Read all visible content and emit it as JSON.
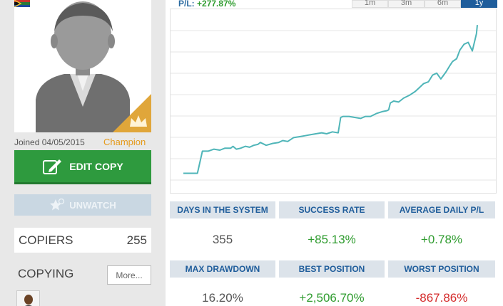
{
  "profile": {
    "joined_text": "Joined 04/05/2015",
    "rank_label": "Champion",
    "edit_copy_label": "EDIT COPY",
    "unwatch_label": "UNWATCH",
    "copiers_label": "COPIERS",
    "copiers_count": "255",
    "copying_label": "COPYING",
    "more_label": "More..."
  },
  "performance": {
    "pl_label": "P/L:",
    "pl_value": "+277.87%",
    "ranges": [
      "1m",
      "3m",
      "6m",
      "1y"
    ],
    "active_range": "1y"
  },
  "stats": {
    "days_label": "DAYS IN THE SYSTEM",
    "days_value": "355",
    "success_label": "SUCCESS RATE",
    "success_value": "+85.13%",
    "avg_label": "AVERAGE DAILY P/L",
    "avg_value": "+0.78%",
    "drawdown_label": "MAX DRAWDOWN",
    "drawdown_value": "16.20%",
    "best_label": "BEST POSITION",
    "best_value": "+2,506.70%",
    "worst_label": "WORST POSITION",
    "worst_value": "-867.86%"
  },
  "colors": {
    "line": "#4fb5b8",
    "accent": "#1f5d9b",
    "positive": "#2f9c2f",
    "negative": "#d42a2a"
  },
  "chart_data": {
    "type": "line",
    "title": "",
    "xlabel": "",
    "ylabel": "",
    "grid": true,
    "x": [
      0,
      4,
      9,
      14,
      17,
      23,
      30,
      37,
      44,
      50,
      57,
      60,
      64,
      69,
      75,
      80,
      85,
      90,
      93,
      100,
      108,
      115,
      120,
      126,
      133,
      140,
      147,
      153,
      160,
      167,
      173,
      180,
      187,
      190,
      193,
      200,
      207,
      214,
      220,
      226,
      233,
      240,
      246,
      248,
      250,
      254,
      260,
      266,
      273,
      280,
      285,
      290,
      296,
      301,
      306,
      311,
      317,
      322,
      325,
      330,
      334,
      339,
      344,
      349,
      354,
      355
    ],
    "y": [
      0,
      0,
      0,
      0,
      0,
      2.3,
      2.3,
      2.5,
      2.4,
      2.6,
      2.6,
      2.8,
      2.5,
      2.6,
      2.8,
      2.7,
      2.9,
      3.0,
      3.2,
      2.9,
      3.1,
      3.2,
      3.4,
      3.3,
      3.7,
      3.8,
      3.9,
      4.0,
      4.1,
      4.2,
      4.1,
      4.3,
      4.2,
      5.8,
      5.9,
      5.9,
      5.8,
      5.7,
      5.9,
      5.9,
      6.2,
      6.4,
      6.5,
      6.6,
      7.3,
      7.5,
      7.4,
      7.8,
      8.1,
      8.5,
      8.9,
      9.3,
      9.5,
      10.2,
      10.4,
      9.8,
      10.5,
      11.2,
      11.6,
      11.9,
      12.8,
      13.4,
      13.6,
      12.7,
      14.5,
      15.4
    ],
    "ylim": [
      -1,
      16
    ]
  }
}
